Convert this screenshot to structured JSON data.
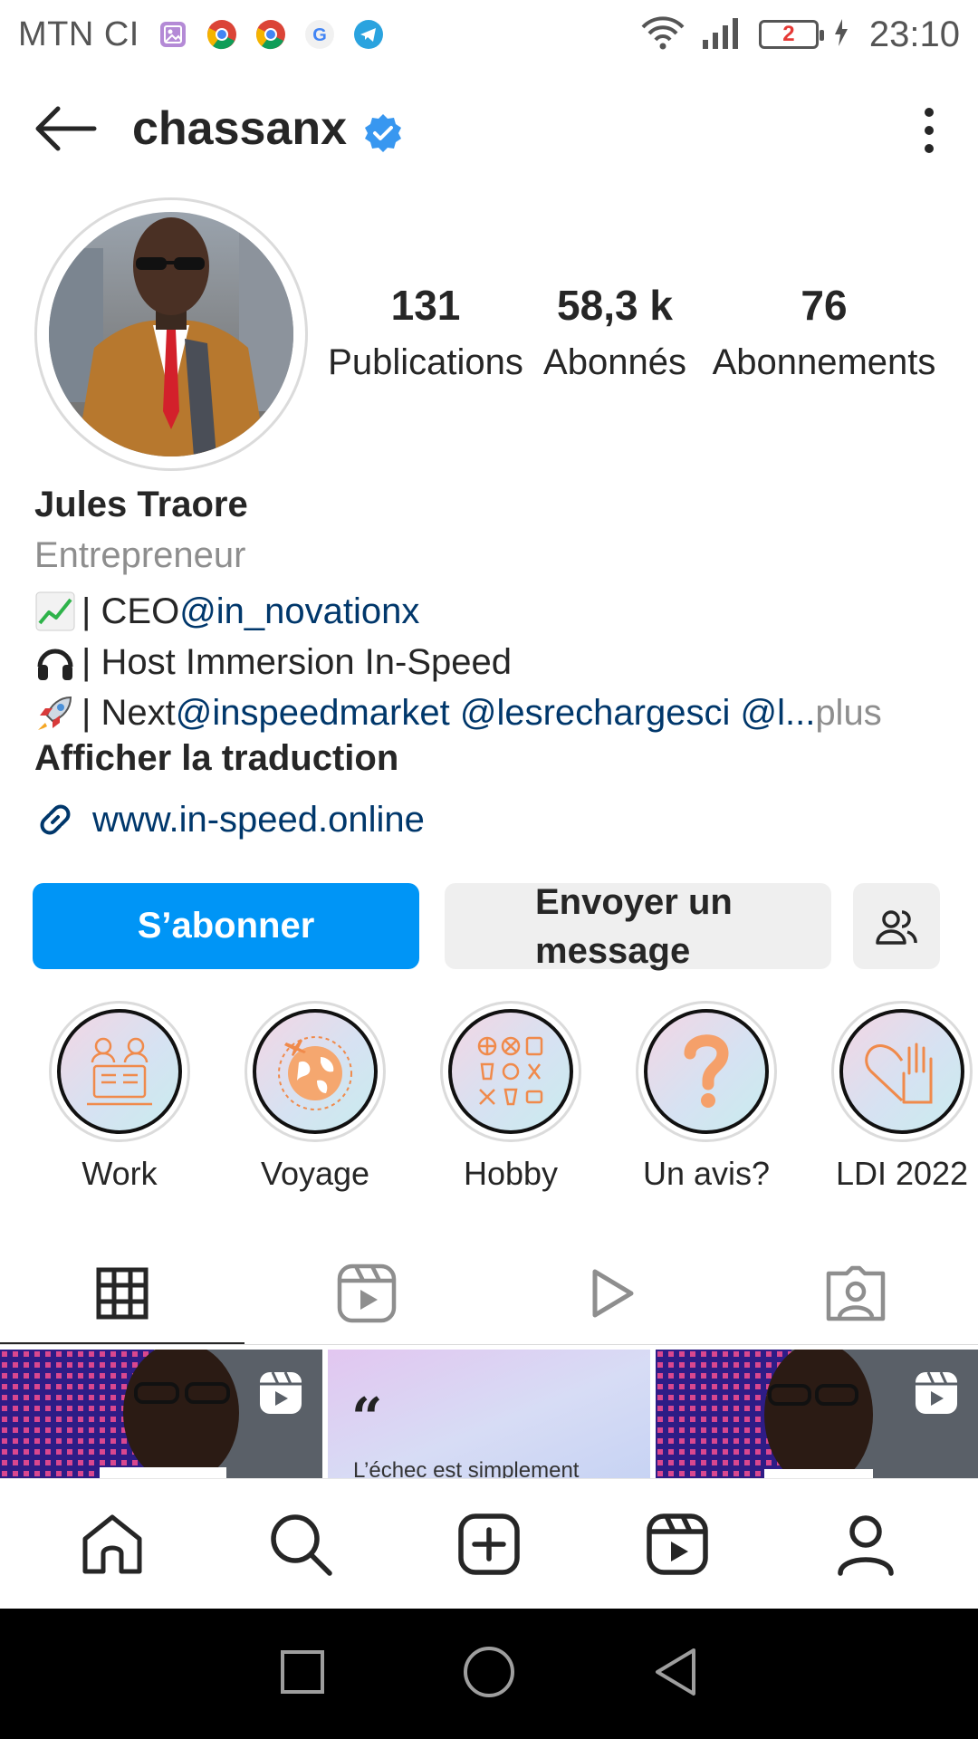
{
  "status_bar": {
    "carrier": "MTN CI",
    "battery_level": "2",
    "time": "23:10"
  },
  "header": {
    "username": "chassanx",
    "verified": true
  },
  "profile": {
    "stats": {
      "posts_count": "131",
      "posts_label": "Publications",
      "followers_count": "58,3 k",
      "followers_label": "Abonnés",
      "following_count": "76",
      "following_label": "Abonnements"
    },
    "name": "Jules Traore",
    "category": "Entrepreneur",
    "bio": {
      "line1_text": "| CEO ",
      "line1_mention": "@in_novationx",
      "line2_text": "| Host Immersion In-Speed",
      "line3_text": "| Next ",
      "line3_mention1": "@inspeedmarket",
      "line3_mention2": "@lesrechargesci",
      "line3_mention3": "@l...",
      "line3_more": " plus"
    },
    "translate_label": "Afficher la traduction",
    "website": "www.in-speed.online"
  },
  "actions": {
    "follow_label": "S’abonner",
    "message_label": "Envoyer un message"
  },
  "highlights": [
    {
      "label": "Work",
      "icon": "meeting-icon"
    },
    {
      "label": "Voyage",
      "icon": "globe-plane-icon"
    },
    {
      "label": "Hobby",
      "icon": "sports-icons"
    },
    {
      "label": "Un avis?",
      "icon": "question-mark-icon"
    },
    {
      "label": "LDI 2022",
      "icon": "heart-hand-icon"
    }
  ],
  "tabs": [
    {
      "name": "grid",
      "active": true
    },
    {
      "name": "reels",
      "active": false
    },
    {
      "name": "videos",
      "active": false
    },
    {
      "name": "tagged",
      "active": false
    }
  ],
  "posts": {
    "quote_preview": "L’échec est simplement"
  },
  "colors": {
    "accent": "#0095f6",
    "mention": "#00376b",
    "verified": "#3897f0",
    "highlight_icon": "#f08a4b"
  }
}
